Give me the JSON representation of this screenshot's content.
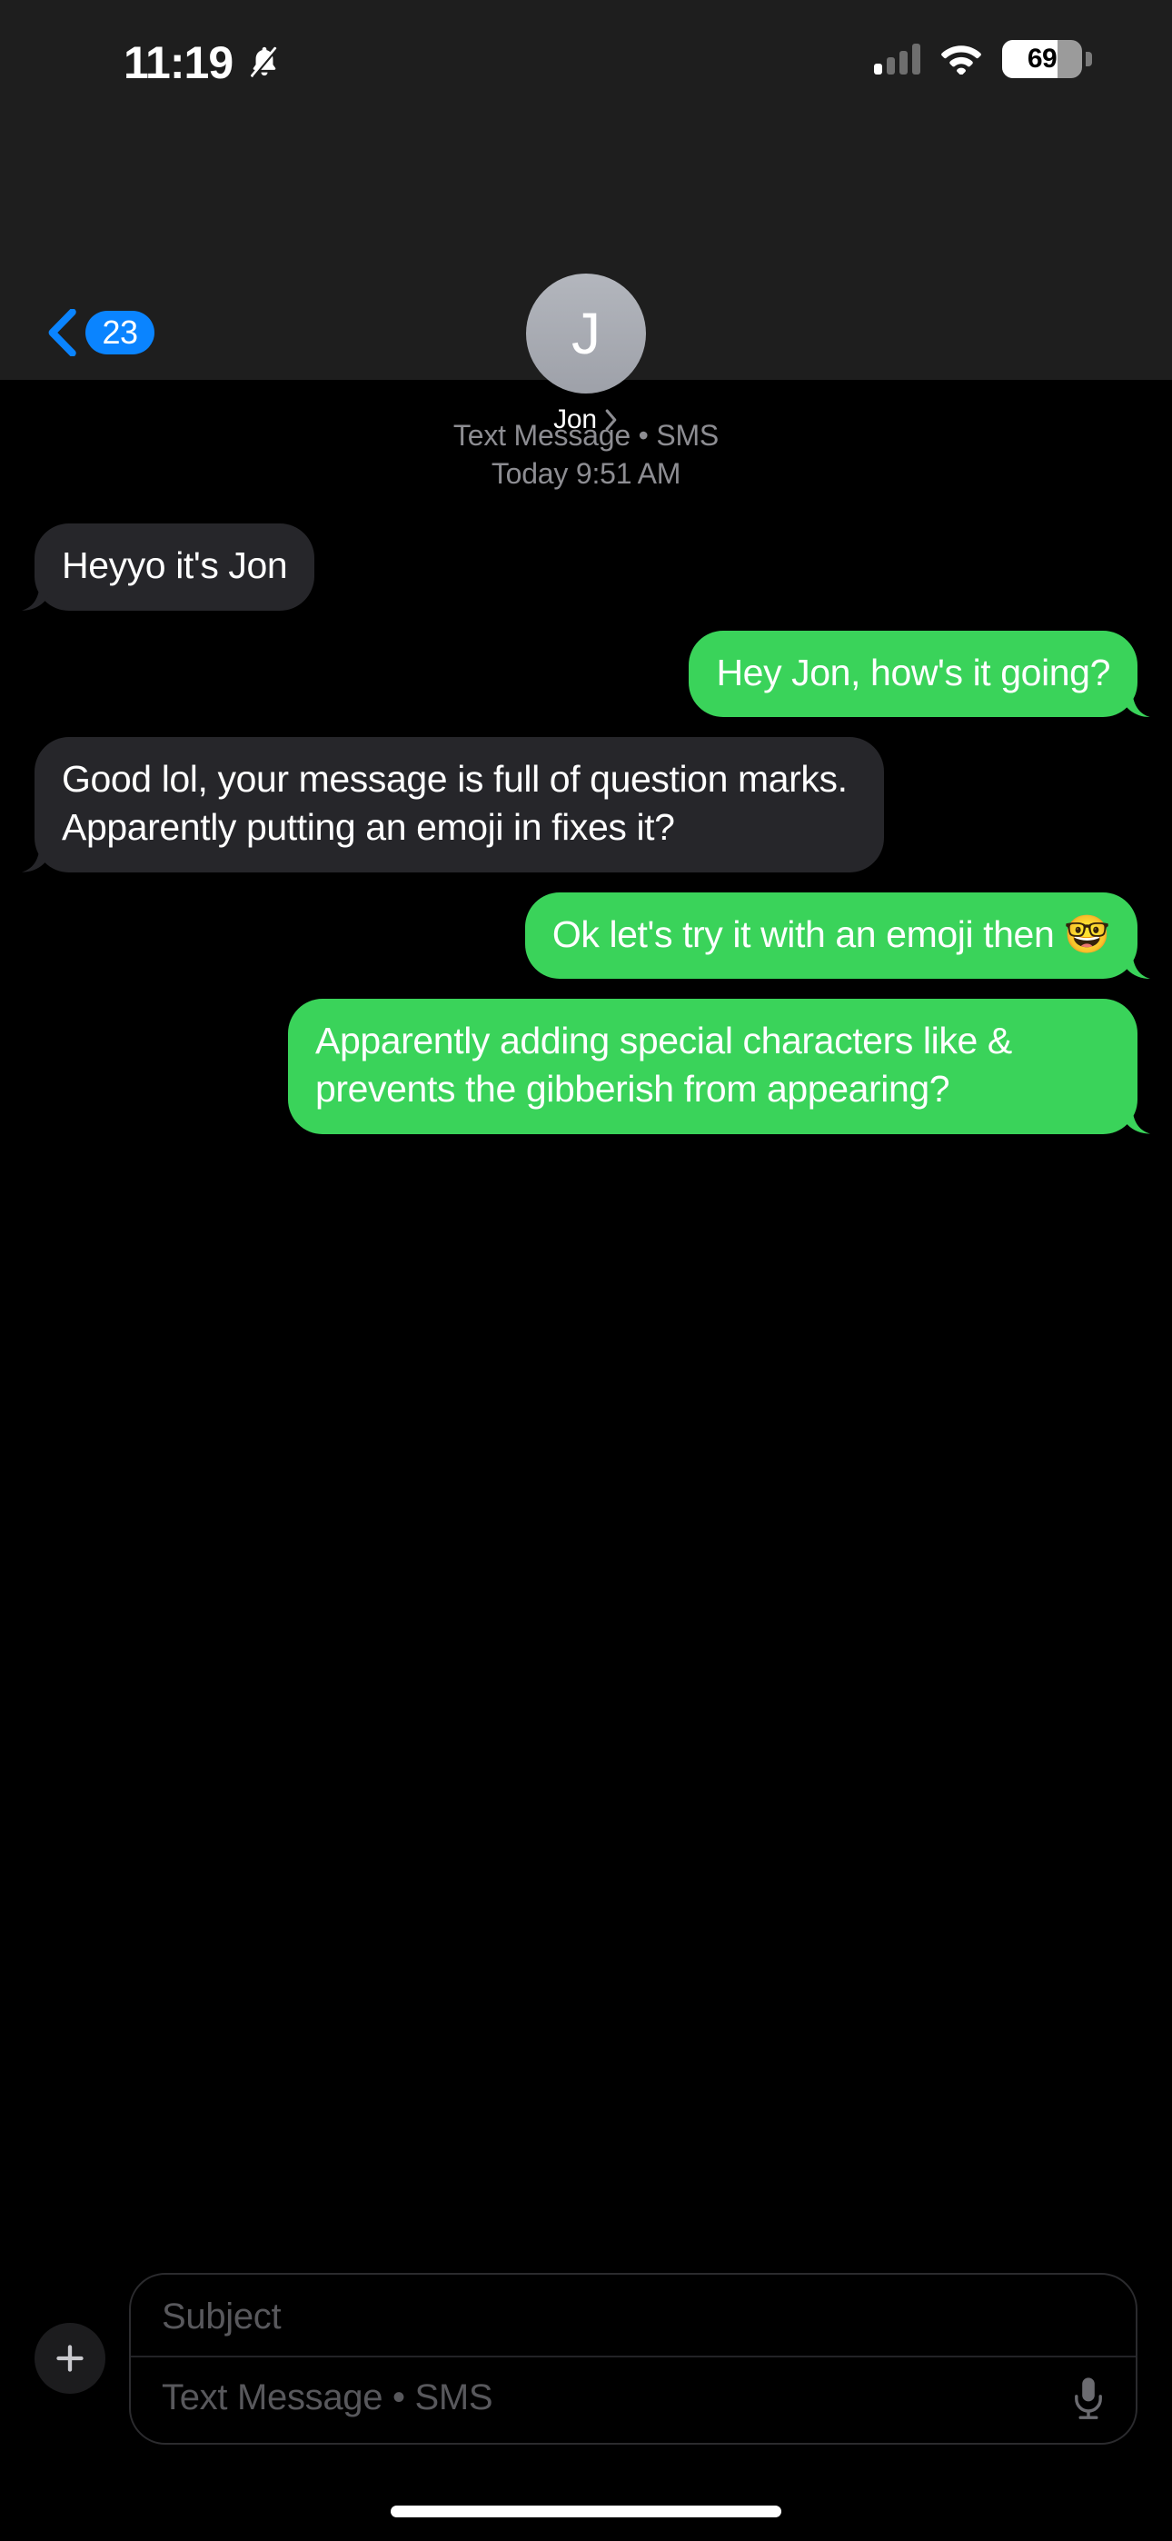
{
  "status_bar": {
    "time": "11:19",
    "silent_icon": "bell-slash-icon",
    "signal_icon": "cellular-signal-icon",
    "signal_bars_active": 1,
    "signal_bars_total": 4,
    "wifi_icon": "wifi-icon",
    "battery_percent": "69",
    "battery_level": 69
  },
  "nav": {
    "back_icon": "chevron-left-icon",
    "unread_count": "23",
    "avatar_initial": "J",
    "contact_name": "Jon",
    "details_icon": "chevron-right-icon"
  },
  "conversation": {
    "service_label": "Text Message • SMS",
    "timestamp": "Today 9:51 AM",
    "messages": [
      {
        "direction": "in",
        "text": "Heyyo it's Jon"
      },
      {
        "direction": "out",
        "text": "Hey Jon, how's it going?"
      },
      {
        "direction": "in",
        "text": "Good lol, your message is full of question marks. Apparently putting an emoji in fixes it?"
      },
      {
        "direction": "out",
        "text": "Ok let's try it with an emoji then 🤓"
      },
      {
        "direction": "out",
        "text": "Apparently adding special characters like & prevents the gibberish from appearing?"
      }
    ]
  },
  "composer": {
    "add_icon": "plus-icon",
    "subject_placeholder": "Subject",
    "message_placeholder": "Text Message • SMS",
    "mic_icon": "microphone-icon"
  },
  "colors": {
    "outgoing_bubble": "#3ad35a",
    "incoming_bubble": "#26262a",
    "accent_blue": "#0a84ff",
    "header_bg": "#1e1e1e",
    "background": "#000000"
  }
}
